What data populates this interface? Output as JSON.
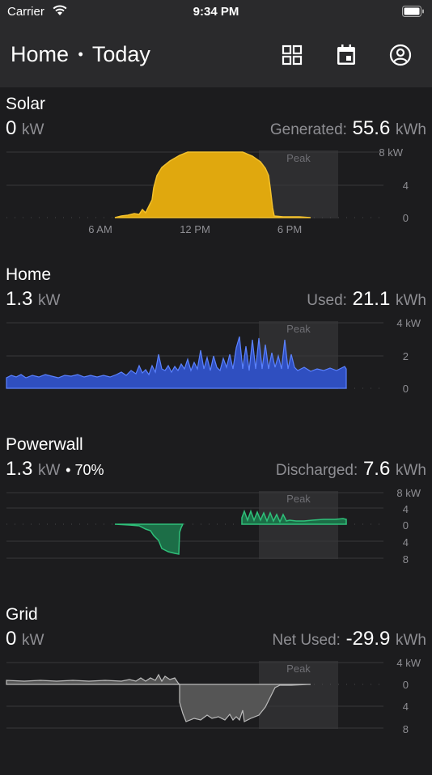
{
  "status_bar": {
    "carrier": "Carrier",
    "time": "9:34 PM"
  },
  "header": {
    "title": "Home",
    "separator": "•",
    "period": "Today",
    "icons": [
      "grid-icon",
      "calendar-icon",
      "account-icon"
    ]
  },
  "peak_label": "Peak",
  "x_ticks": [
    "6 AM",
    "12 PM",
    "6 PM"
  ],
  "sections": {
    "solar": {
      "title": "Solar",
      "power": "0",
      "power_unit": "kW",
      "total_label": "Generated:",
      "total_value": "55.6",
      "total_unit": "kWh",
      "y_ticks": [
        "8 kW",
        "4",
        "0"
      ],
      "color": "#e0a80e"
    },
    "home": {
      "title": "Home",
      "power": "1.3",
      "power_unit": "kW",
      "total_label": "Used:",
      "total_value": "21.1",
      "total_unit": "kWh",
      "y_ticks": [
        "4 kW",
        "2",
        "0"
      ],
      "color": "#3b63d9"
    },
    "powerwall": {
      "title": "Powerwall",
      "power": "1.3",
      "power_unit": "kW",
      "charge": "• 70%",
      "total_label": "Discharged:",
      "total_value": "7.6",
      "total_unit": "kWh",
      "y_ticks": [
        "8 kW",
        "4",
        "0",
        "4",
        "8"
      ],
      "color": "#2fc07a"
    },
    "grid": {
      "title": "Grid",
      "power": "0",
      "power_unit": "kW",
      "total_label": "Net Used:",
      "total_value": "-29.9",
      "total_unit": "kWh",
      "y_ticks": [
        "4 kW",
        "0",
        "4",
        "8"
      ],
      "color": "#a0a0a0"
    }
  },
  "chart_data": [
    {
      "type": "area",
      "title": "Solar",
      "ylabel": "kW",
      "ylim": [
        0,
        8
      ],
      "x_hours": [
        6.5,
        7,
        7.5,
        7.8,
        8,
        8.2,
        8.5,
        9,
        9.5,
        10,
        11,
        12,
        13,
        14,
        15,
        15.8,
        16.3,
        16.7,
        17,
        18,
        19
      ],
      "values": [
        0,
        0.2,
        0.4,
        0.8,
        1.5,
        2.0,
        3.0,
        5.5,
        6.6,
        7.2,
        7.7,
        8.0,
        8.0,
        8.0,
        7.6,
        6.8,
        4.5,
        0.6,
        0.3,
        0.15,
        0
      ]
    },
    {
      "type": "area",
      "title": "Home",
      "ylabel": "kW",
      "ylim": [
        0,
        4
      ],
      "x_hours": [
        0,
        1,
        2,
        3,
        4,
        5,
        6,
        7,
        8,
        9,
        10,
        11,
        12,
        13,
        14,
        15,
        16,
        17,
        18,
        19,
        20,
        21
      ],
      "values": [
        0.6,
        0.7,
        0.55,
        0.6,
        0.6,
        0.7,
        0.65,
        0.7,
        1.4,
        1.6,
        1.3,
        1.2,
        1.4,
        2.2,
        3.1,
        3.0,
        2.7,
        3.0,
        1.5,
        0.9,
        1.1,
        1.4
      ]
    },
    {
      "type": "area",
      "title": "Powerwall",
      "ylabel": "kW",
      "ylim": [
        -8,
        8
      ],
      "x_hours": [
        7,
        8,
        9,
        10,
        10.5,
        11,
        15,
        16,
        17,
        18,
        19,
        20,
        21
      ],
      "values": [
        0,
        -0.3,
        -1.5,
        -5.0,
        -6.5,
        -1.0,
        1.2,
        2.8,
        1.0,
        1.4,
        1.1,
        1.2,
        1.5
      ]
    },
    {
      "type": "area",
      "title": "Grid",
      "ylabel": "kW",
      "ylim": [
        -8,
        4
      ],
      "x_hours": [
        0,
        2,
        4,
        6,
        8,
        9,
        10,
        11,
        12,
        13,
        14,
        15,
        16,
        17,
        18,
        19
      ],
      "values": [
        1.2,
        1.1,
        1.2,
        1.3,
        1.6,
        1.4,
        2.2,
        1.3,
        -7.8,
        -7.2,
        -6.5,
        -6.8,
        -5.8,
        -2.5,
        0,
        0.1
      ]
    }
  ]
}
